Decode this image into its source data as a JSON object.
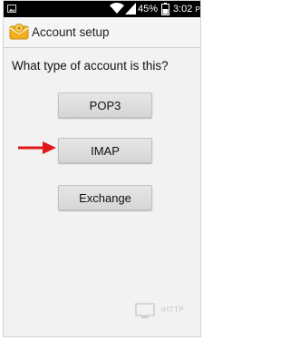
{
  "status_bar": {
    "battery": "45%",
    "time": "3:02",
    "ampm": "PM"
  },
  "action_bar": {
    "title": "Account setup"
  },
  "question": "What type of account is this?",
  "options": {
    "pop3": "POP3",
    "imap": "IMAP",
    "exchange": "Exchange"
  },
  "watermark": "iHTTP",
  "colors": {
    "arrow": "#e01818",
    "app_icon": "#f0b020"
  },
  "icons": {
    "status_left": "picture-icon",
    "wifi": "wifi-icon",
    "signal": "signal-icon",
    "battery": "battery-icon",
    "app": "email-setup-icon",
    "annotation": "red-arrow-icon"
  }
}
